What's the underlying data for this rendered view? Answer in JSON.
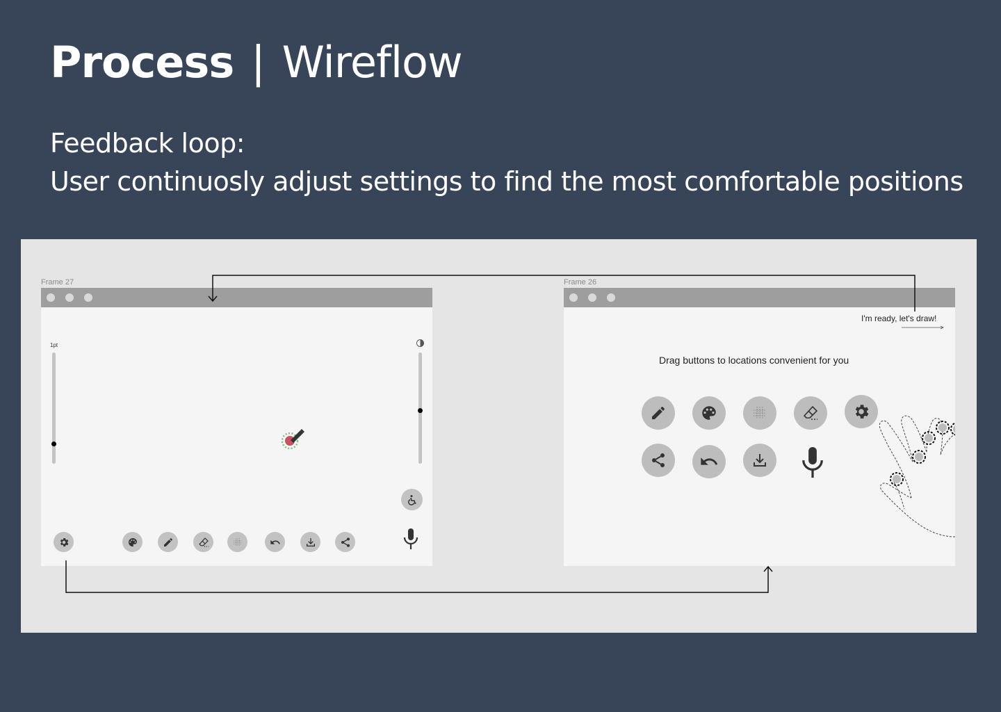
{
  "header": {
    "title_bold": "Process",
    "title_sep": "|",
    "title_light": "Wireflow",
    "subtitle_line1": "Feedback loop:",
    "subtitle_line2": "User continuosly adjust settings to find the most comfortable positions"
  },
  "frame_left": {
    "label": "Frame 27",
    "slider_label": "1pt",
    "slider_left_value": 0.17,
    "slider_right_value": 0.53,
    "toolbar_icons": [
      "gear-icon",
      "palette-icon",
      "pencil-icon",
      "eraser-icon",
      "grid-icon",
      "undo-icon",
      "download-icon",
      "share-icon",
      "microphone-icon"
    ],
    "accessibility_icon": "wheelchair-icon"
  },
  "frame_right": {
    "label": "Frame 26",
    "ready_text": "I'm ready, let's draw!",
    "instruction": "Drag buttons to locations convenient for you",
    "row1_icons": [
      "pencil-icon",
      "palette-icon",
      "grid-icon",
      "eraser-icon",
      "gear-icon"
    ],
    "row2_icons": [
      "share-icon",
      "undo-icon",
      "download-icon",
      "microphone-icon"
    ]
  },
  "colors": {
    "background": "#384559",
    "canvas": "#e5e5e5",
    "frame": "#f5f5f5",
    "titlebar": "#9e9e9e",
    "button": "#c2c2c2",
    "icon": "#3a3a3a",
    "cursor_red": "#c85060",
    "cursor_ring": "#7cc47c"
  }
}
